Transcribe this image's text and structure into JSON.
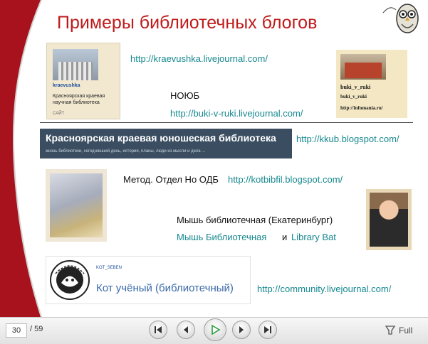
{
  "slide": {
    "title": "Примеры библиотечных блогов",
    "blogs": {
      "kraevushka_url": "http://kraevushka.livejournal.com/",
      "kraevushka_thumb": {
        "nick": "kraevushka",
        "description": "Красноярская краевая научная библиотека",
        "site": "САЙТ"
      },
      "noub_label": "НОЮБ",
      "buki_url": "http://buki-v-ruki.livejournal.com/",
      "buki_thumb": {
        "nick": "buki_v_ruki",
        "line2": "buki_v_ruki",
        "line3": "http://infomania.ru/"
      },
      "kkub_banner": {
        "heading": "Красноярская краевая юношеская библиотека",
        "subheading": "жизнь библиотеки, сегодняшний день, история, планы, люди из мысли и дела ..."
      },
      "kkub_url": "http://kkub.blogspot.com/",
      "metod_label": "Метод. Отдел Но ОДБ",
      "kotbibfil_url": "http://kotbibfil.blogspot.com/",
      "mouse_label": "Мышь библиотечная (Екатеринбург)",
      "mouse_link": "Мышь Библиотечная",
      "and_text": "и",
      "librarybat_link": "Library Bat",
      "kot_thumb": {
        "nick": "KOT_SEBEN",
        "name": "Кот учёный (библиотечный)"
      },
      "community_url": "http://community.livejournal.com/"
    }
  },
  "toolbar": {
    "current_page": "30",
    "total_pages": "/ 59",
    "full_label": "Full",
    "buttons": [
      "first-slide-icon",
      "previous-slide-icon",
      "play-icon",
      "next-slide-icon",
      "last-slide-icon"
    ]
  },
  "colors": {
    "title": "#c01a1a",
    "link": "#16888f",
    "curve": "#a8121d",
    "banner": "#3b4e61"
  }
}
